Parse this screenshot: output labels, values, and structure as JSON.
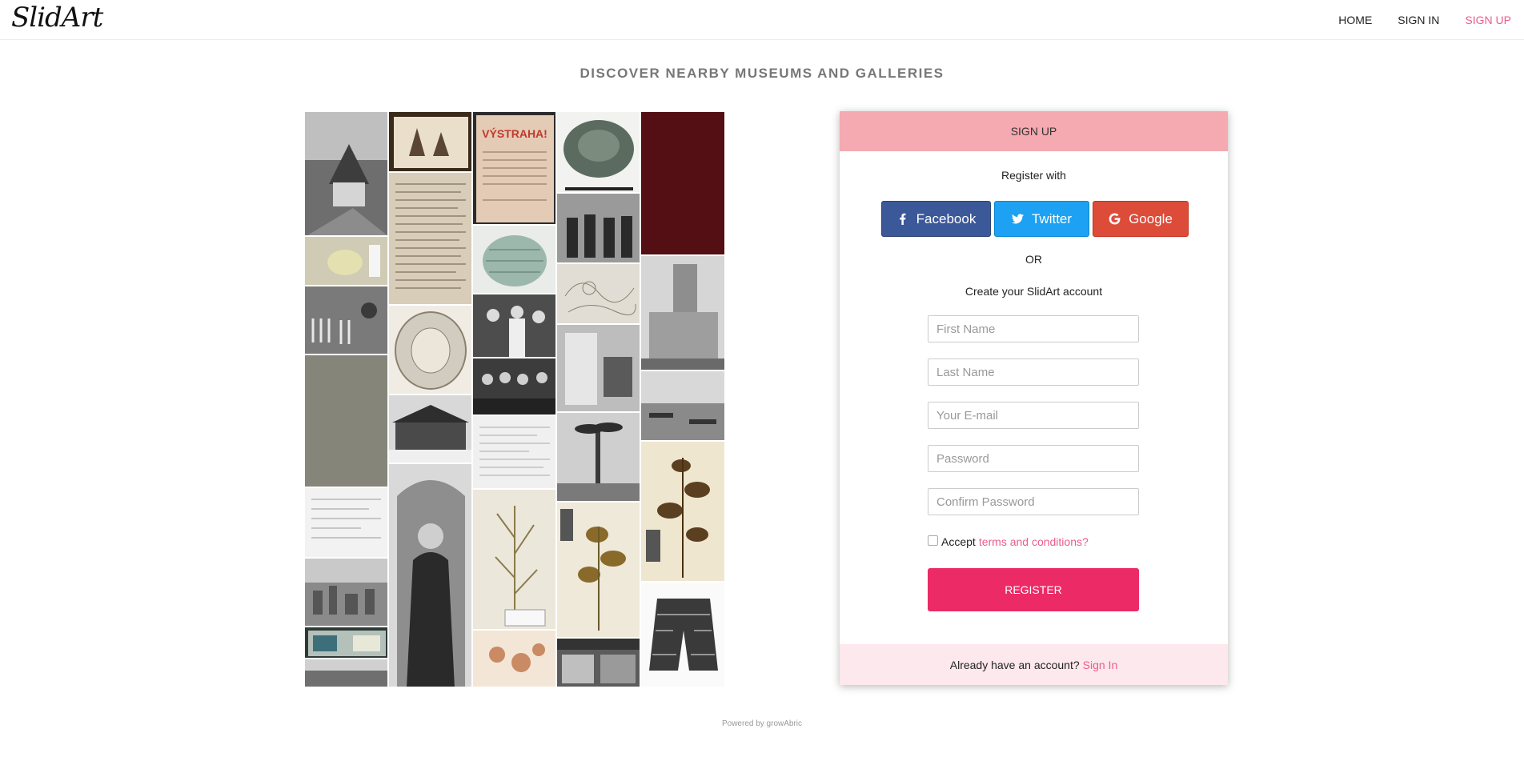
{
  "brand": {
    "logo_text": "SlidArt"
  },
  "nav": {
    "items": [
      {
        "label": "HOME",
        "active": false
      },
      {
        "label": "SIGN IN",
        "active": false
      },
      {
        "label": "SIGN UP",
        "active": true
      }
    ]
  },
  "heading": "DISCOVER NEARBY MUSEUMS AND GALLERIES",
  "signup": {
    "header": "SIGN UP",
    "register_with": "Register with",
    "social": [
      {
        "label": "Facebook",
        "icon": "facebook-icon"
      },
      {
        "label": "Twitter",
        "icon": "twitter-icon"
      },
      {
        "label": "Google",
        "icon": "google-icon"
      }
    ],
    "or": "OR",
    "create_account": "Create your SlidArt account",
    "fields": [
      {
        "placeholder": "First Name",
        "value": ""
      },
      {
        "placeholder": "Last Name",
        "value": ""
      },
      {
        "placeholder": "Your E-mail",
        "value": ""
      },
      {
        "placeholder": "Password",
        "value": ""
      },
      {
        "placeholder": "Confirm Password",
        "value": ""
      }
    ],
    "accept_prefix": "Accept",
    "accept_link": "terms and conditions?",
    "register_label": "REGISTER",
    "footer_prefix": "Already have an account?",
    "footer_link": "Sign In"
  },
  "footer": {
    "powered_by": "Powered by growAbric"
  },
  "colors": {
    "accent": "#ec5b8e",
    "register": "#ec2a66",
    "header_bg": "#f5a9b0",
    "footer_bg": "#fde8ee",
    "facebook": "#3b5998",
    "twitter": "#1da1f2",
    "google": "#dd4b39"
  },
  "mosaic_tiles": [
    {
      "name": "church-photo",
      "tone": "#6e6e6e"
    },
    {
      "name": "drawing-trees",
      "tone": "#b7a58a"
    },
    {
      "name": "vystraha-poster",
      "tone": "#d9b9a4"
    },
    {
      "name": "bronze-plate",
      "tone": "#5b6b60"
    },
    {
      "name": "dark-red-textile",
      "tone": "#4a0d10"
    },
    {
      "name": "handwritten-letter",
      "tone": "#d8cdb8"
    },
    {
      "name": "specimen-slide",
      "tone": "#cfcbb5"
    },
    {
      "name": "ceramic-vessel",
      "tone": "#9cb8ad"
    },
    {
      "name": "crowd-photo",
      "tone": "#585858"
    },
    {
      "name": "zebra-photo",
      "tone": "#7a7a7a"
    },
    {
      "name": "ornamental-plate",
      "tone": "#d2ccc0"
    },
    {
      "name": "wedding-photo",
      "tone": "#4d4d4d"
    },
    {
      "name": "map-sketch",
      "tone": "#d5cfc4"
    },
    {
      "name": "tower-building",
      "tone": "#8e8e8e"
    },
    {
      "name": "grey-panel",
      "tone": "#85857a"
    },
    {
      "name": "group-portrait",
      "tone": "#3c3c3c"
    },
    {
      "name": "interior-photo",
      "tone": "#9a9a9a"
    },
    {
      "name": "river-scene",
      "tone": "#a4a4a4"
    },
    {
      "name": "wooden-house",
      "tone": "#7d7d7d"
    },
    {
      "name": "document-form",
      "tone": "#e6e6e6"
    },
    {
      "name": "palm-tree-photo",
      "tone": "#6a6a6a"
    },
    {
      "name": "herbarium-leaves",
      "tone": "#c8b68e"
    },
    {
      "name": "typed-document",
      "tone": "#f0f0f0"
    },
    {
      "name": "saint-painting",
      "tone": "#4e4e4e"
    },
    {
      "name": "herbarium-grass",
      "tone": "#e2ddcd"
    },
    {
      "name": "herbarium-flower",
      "tone": "#d9cdb0"
    },
    {
      "name": "city-view",
      "tone": "#8a8a8a"
    },
    {
      "name": "mineral-slide",
      "tone": "#b4c0ba"
    },
    {
      "name": "bottom-strip-photo",
      "tone": "#6f6f6f"
    },
    {
      "name": "red-chalk-sketch",
      "tone": "#e1c2a4"
    },
    {
      "name": "street-shop",
      "tone": "#5c5c5c"
    },
    {
      "name": "lace-garment",
      "tone": "#bdbdbd"
    }
  ]
}
